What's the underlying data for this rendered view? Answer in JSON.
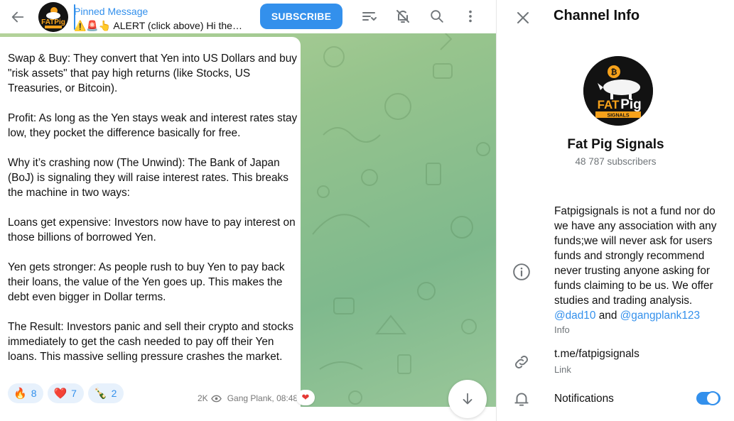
{
  "header": {
    "pinned_title": "Pinned Message",
    "pinned_text": "⚠️🚨👆 ALERT (click above) Hi there, from",
    "subscribe_label": "SUBSCRIBE"
  },
  "message": {
    "paragraphs": [
      "Swap & Buy: They convert that Yen into US Dollars and buy \"risk assets\" that pay high returns (like Stocks, US Treasuries, or Bitcoin).",
      "Profit: As long as the Yen stays weak and interest rates stay low, they pocket the difference basically for free.",
      "Why it’s crashing now (The Unwind): The Bank of Japan (BoJ) is signaling they will raise interest rates. This breaks the machine in two ways:",
      "Loans get expensive: Investors now have to pay interest on those billions of borrowed Yen.",
      "Yen gets stronger: As people rush to buy Yen to pay back their loans, the value of the Yen goes up. This makes the debt even bigger in Dollar terms.",
      "The Result: Investors panic and sell their crypto and stocks immediately to get the cash needed to pay off their Yen loans. This massive selling pressure crashes the market."
    ],
    "reactions": [
      {
        "emoji": "🔥",
        "count": "8"
      },
      {
        "emoji": "❤️",
        "count": "7"
      },
      {
        "emoji": "🍾",
        "count": "2"
      }
    ],
    "views": "2K",
    "author_time": "Gang Plank, 08:48",
    "own_reaction": "❤"
  },
  "panel": {
    "title": "Channel Info",
    "channel_name": "Fat Pig Signals",
    "subscribers": "48 787 subscribers",
    "logo_top": "FAT",
    "logo_bottom": "Pig",
    "logo_strip": "SIGNALS",
    "description": "Fatpigsignals is not a fund nor do we have any association with any funds;we will never ask for users funds and strongly recommend never trusting anyone asking for funds claiming to be us. We offer studies and trading analysis.",
    "mention_1": "@dad10",
    "mention_join": "and",
    "mention_2": "@gangplank123",
    "info_label": "Info",
    "link_value": "t.me/fatpigsignals",
    "link_label": "Link",
    "notifications_label": "Notifications",
    "notifications_on": true
  },
  "colors": {
    "accent": "#3390ec",
    "chat_background": "#97c48d"
  }
}
